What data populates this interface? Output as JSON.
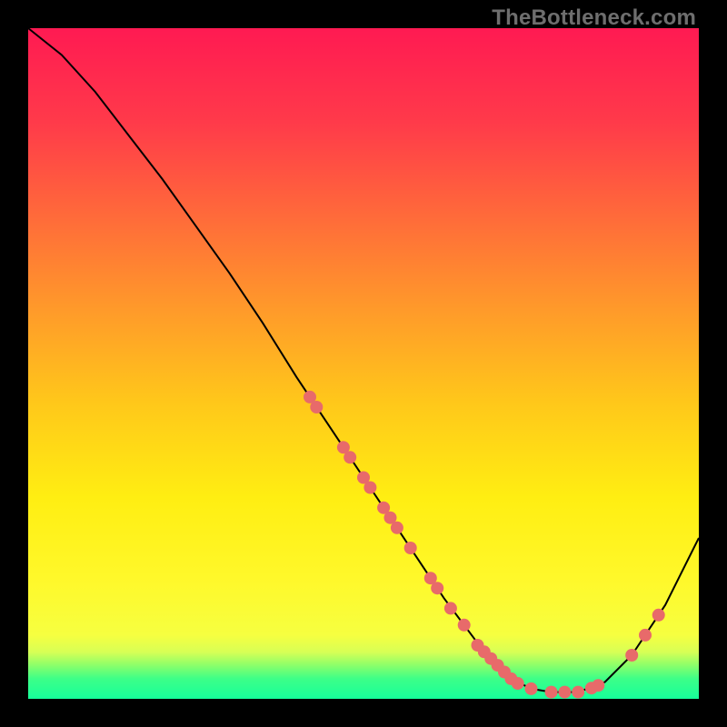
{
  "watermark": "TheBottleneck.com",
  "chart_data": {
    "type": "line",
    "title": "",
    "xlabel": "",
    "ylabel": "",
    "xlim": [
      0,
      100
    ],
    "ylim": [
      0,
      100
    ],
    "grid": false,
    "legend": false,
    "series": [
      {
        "name": "bottleneck-curve",
        "x": [
          0,
          5,
          10,
          15,
          20,
          25,
          30,
          35,
          40,
          45,
          50,
          55,
          60,
          62,
          65,
          68,
          70,
          72,
          75,
          78,
          82,
          86,
          90,
          95,
          100
        ],
        "y": [
          100,
          96,
          90.5,
          84,
          77.5,
          70.5,
          63.5,
          56,
          48,
          40.5,
          33,
          25.5,
          18,
          15,
          11,
          7,
          5,
          3,
          1.5,
          1,
          1,
          2.5,
          6.5,
          14,
          24
        ],
        "stroke": "#000000",
        "stroke_width": 2
      }
    ],
    "markers": [
      {
        "name": "curve-dots",
        "shape": "circle",
        "fill": "#e86a6a",
        "radius_px": 7,
        "points": [
          {
            "x": 42,
            "y": 45
          },
          {
            "x": 43,
            "y": 43.5
          },
          {
            "x": 47,
            "y": 37.5
          },
          {
            "x": 48,
            "y": 36
          },
          {
            "x": 50,
            "y": 33
          },
          {
            "x": 51,
            "y": 31.5
          },
          {
            "x": 53,
            "y": 28.5
          },
          {
            "x": 54,
            "y": 27
          },
          {
            "x": 55,
            "y": 25.5
          },
          {
            "x": 57,
            "y": 22.5
          },
          {
            "x": 60,
            "y": 18
          },
          {
            "x": 61,
            "y": 16.5
          },
          {
            "x": 63,
            "y": 13.5
          },
          {
            "x": 65,
            "y": 11
          },
          {
            "x": 67,
            "y": 8
          },
          {
            "x": 68,
            "y": 7
          },
          {
            "x": 69,
            "y": 6
          },
          {
            "x": 70,
            "y": 5
          },
          {
            "x": 71,
            "y": 4
          },
          {
            "x": 72,
            "y": 3
          },
          {
            "x": 73,
            "y": 2.3
          },
          {
            "x": 75,
            "y": 1.5
          },
          {
            "x": 78,
            "y": 1
          },
          {
            "x": 80,
            "y": 1
          },
          {
            "x": 82,
            "y": 1
          },
          {
            "x": 84,
            "y": 1.6
          },
          {
            "x": 85,
            "y": 2
          },
          {
            "x": 90,
            "y": 6.5
          },
          {
            "x": 92,
            "y": 9.5
          },
          {
            "x": 94,
            "y": 12.5
          }
        ]
      }
    ]
  }
}
